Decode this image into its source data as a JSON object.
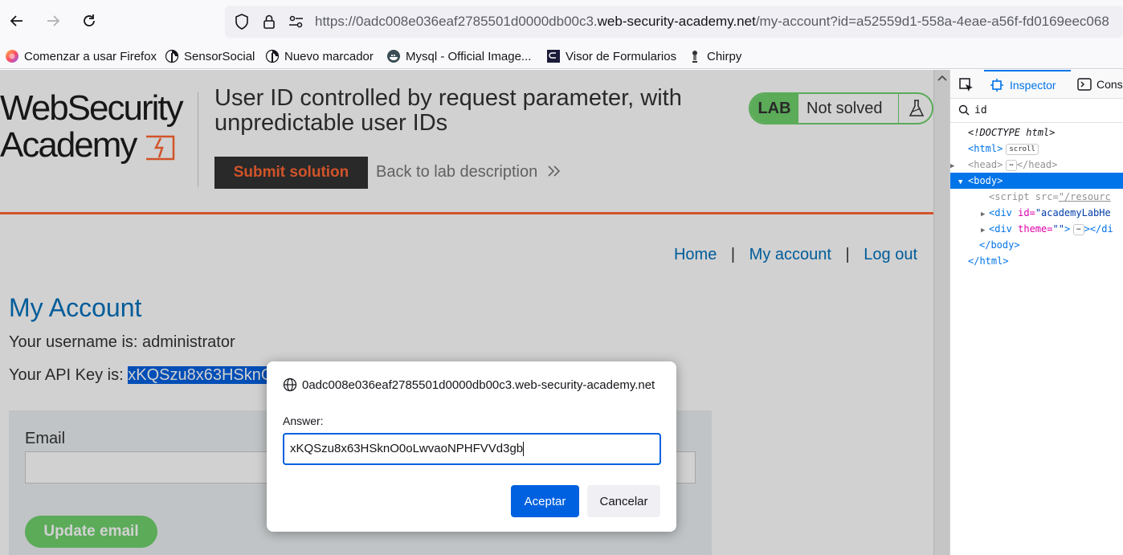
{
  "browser": {
    "url_prefix": "https://0adc008e036eaf2785501d0000db00c3.",
    "url_domain": "web-security-academy.net",
    "url_suffix": "/my-account?id=a52559d1-558a-4eae-a56f-fd0169eec068"
  },
  "bookmarks": [
    {
      "label": "Comenzar a usar Firefox",
      "icon": "firefox-icon"
    },
    {
      "label": "SensorSocial",
      "icon": "bookmark-site-icon"
    },
    {
      "label": "Nuevo marcador",
      "icon": "bookmark-site-icon"
    },
    {
      "label": "Mysql - Official Image...",
      "icon": "docker-icon"
    },
    {
      "label": "Visor de Formularios",
      "icon": "form-viewer-icon"
    },
    {
      "label": "Chirpy",
      "icon": "chirpy-icon"
    }
  ],
  "page": {
    "logo_line1": "WebSecurity",
    "logo_line2": "Academy",
    "lab_title": "User ID controlled by request parameter, with unpredictable user IDs",
    "submit_label": "Submit solution",
    "back_label": "Back to lab description",
    "lab_badge": "LAB",
    "lab_status": "Not solved",
    "nav": {
      "home": "Home",
      "sep1": "|",
      "account": "My account",
      "sep2": "|",
      "logout": "Log out"
    },
    "heading": "My Account",
    "username_line": "Your username is: administrator",
    "apikey_prefix": "Your API Key is: ",
    "apikey_visible": "xKQSzu8x63HSknO",
    "email_label": "Email",
    "update_label": "Update email"
  },
  "dialog": {
    "origin": "0adc008e036eaf2785501d0000db00c3.web-security-academy.net",
    "label": "Answer:",
    "value": "xKQSzu8x63HSknO0oLwvaoNPHFVVd3gb",
    "accept": "Aceptar",
    "cancel": "Cancelar"
  },
  "devtools": {
    "inspector_tab": "Inspector",
    "console_tab": "Cons",
    "search_query": "id",
    "tree": {
      "doctype": "<!DOCTYPE html>",
      "html_open": "<html>",
      "scroll_badge": "scroll",
      "head": "<head>",
      "head_close": "</head>",
      "body_open": "<body>",
      "script_tag": "<script ",
      "script_attr": "src=",
      "script_val": "\"/resourc",
      "div1_tag": "<div ",
      "div1_attr": "id=",
      "div1_val": "\"academyLabHe",
      "div2_tag": "<div ",
      "div2_attr": "theme=",
      "div2_val": "\"\"",
      "div2_rest": "></di",
      "body_close": "</body>",
      "html_close": "</html>",
      "ellipsis": "⋯"
    }
  },
  "colors": {
    "accent_blue": "#0071bc",
    "wsa_orange": "#ff6633",
    "lab_green": "#70d16d",
    "dialog_primary": "#0061e0"
  }
}
